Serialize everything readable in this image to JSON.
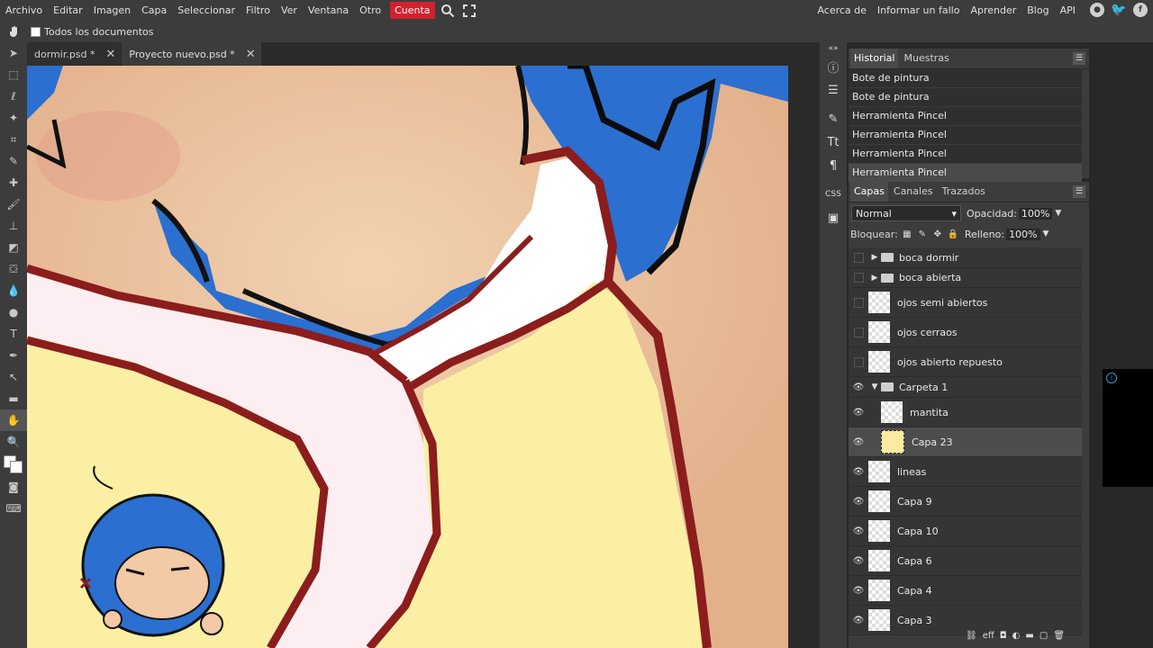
{
  "menubar": {
    "items": [
      "Archivo",
      "Editar",
      "Imagen",
      "Capa",
      "Seleccionar",
      "Filtro",
      "Ver",
      "Ventana",
      "Otro"
    ],
    "account": "Cuenta",
    "right_links": [
      "Acerca de",
      "Informar un fallo",
      "Aprender",
      "Blog",
      "API"
    ]
  },
  "options": {
    "all_documents_label": "Todos los documentos"
  },
  "tabs": [
    {
      "label": "dormir.psd *"
    },
    {
      "label": "Proyecto nuevo.psd *"
    }
  ],
  "history": {
    "tabs": [
      "Historial",
      "Muestras"
    ],
    "entries": [
      "Bote de pintura",
      "Bote de pintura",
      "Herramienta Pincel",
      "Herramienta Pincel",
      "Herramienta Pincel",
      "Herramienta Pincel"
    ]
  },
  "layers": {
    "tabs": [
      "Capas",
      "Canales",
      "Trazados"
    ],
    "blend_mode": "Normal",
    "opacity_label": "Opacidad:",
    "opacity_value": "100%",
    "lock_label": "Bloquear:",
    "fill_label": "Relleno:",
    "fill_value": "100%",
    "items": [
      {
        "name": "boca dormir",
        "type": "folder",
        "visible": false
      },
      {
        "name": "boca abierta",
        "type": "folder",
        "visible": false
      },
      {
        "name": "ojos semi abiertos",
        "type": "layer",
        "visible": false
      },
      {
        "name": "ojos cerraos",
        "type": "layer",
        "visible": false
      },
      {
        "name": "ojos abierto repuesto",
        "type": "layer",
        "visible": false
      },
      {
        "name": "Carpeta 1",
        "type": "folder-open",
        "visible": true
      },
      {
        "name": "mantita",
        "type": "layer",
        "visible": true
      },
      {
        "name": "Capa 23",
        "type": "layer",
        "visible": true,
        "selected": true
      },
      {
        "name": "lineas",
        "type": "layer",
        "visible": true
      },
      {
        "name": "Capa 9",
        "type": "layer",
        "visible": true
      },
      {
        "name": "Capa 10",
        "type": "layer",
        "visible": true
      },
      {
        "name": "Capa 6",
        "type": "layer",
        "visible": true
      },
      {
        "name": "Capa 4",
        "type": "layer",
        "visible": true
      },
      {
        "name": "Capa 3",
        "type": "layer",
        "visible": true
      }
    ]
  },
  "colors": {
    "accent_account": "#d3202f",
    "outline": "#8b1d1d",
    "blanket_yellow": "#fbefa3",
    "hair_blue": "#2a6fd1"
  }
}
